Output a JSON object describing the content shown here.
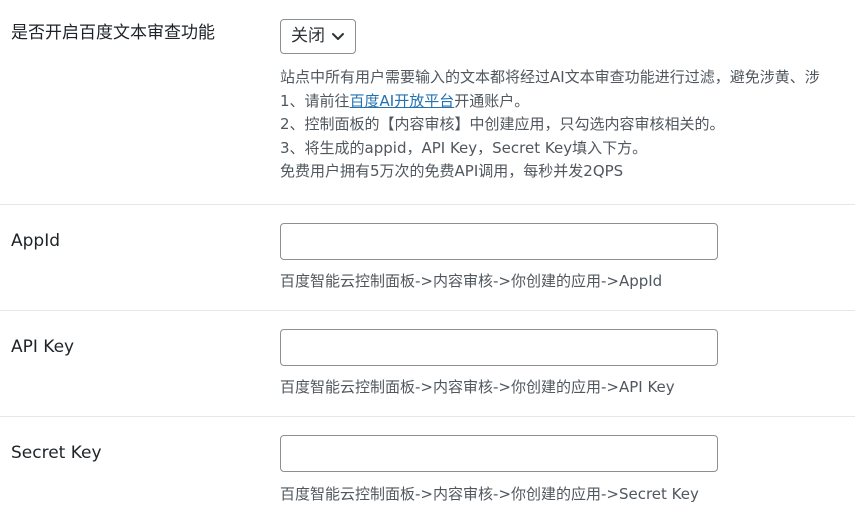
{
  "moderation": {
    "label": "是否开启百度文本审查功能",
    "select_value": "关闭",
    "desc_line1": "站点中所有用户需要输入的文本都将经过AI文本审查功能进行过滤，避免涉黄、涉",
    "desc_line2_prefix": "1、请前往",
    "desc_line2_link": "百度AI开放平台",
    "desc_line2_suffix": "开通账户。",
    "desc_line3": "2、控制面板的【内容审核】中创建应用，只勾选内容审核相关的。",
    "desc_line4": "3、将生成的appid，API Key，Secret Key填入下方。",
    "desc_line5": "免费用户拥有5万次的免费API调用，每秒并发2QPS"
  },
  "appid": {
    "label": "AppId",
    "value": "",
    "hint": "百度智能云控制面板->内容审核->你创建的应用->AppId"
  },
  "apikey": {
    "label": "API Key",
    "value": "",
    "hint": "百度智能云控制面板->内容审核->你创建的应用->API Key"
  },
  "secretkey": {
    "label": "Secret Key",
    "value": "",
    "hint": "百度智能云控制面板->内容审核->你创建的应用->Secret Key"
  }
}
